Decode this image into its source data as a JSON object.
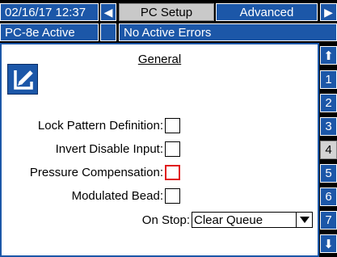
{
  "header": {
    "datetime": "02/16/17 12:37",
    "nav_left": "◀",
    "screen_title": "PC Setup",
    "advanced_tab": "Advanced",
    "nav_right": "▶",
    "status": "PC-8e Active",
    "errors": "No Active Errors"
  },
  "panel": {
    "title": "General",
    "edit_icon": "edit-pencil-icon",
    "settings": [
      {
        "label": "Lock Pattern Definition:",
        "checked": false
      },
      {
        "label": "Invert Disable Input:",
        "checked": false
      },
      {
        "label": "Pressure Compensation:",
        "checked": false,
        "focused": true
      },
      {
        "label": "Modulated Bead:",
        "checked": false
      }
    ],
    "on_stop": {
      "label": "On Stop:",
      "value": "Clear Queue"
    }
  },
  "side_tabs": {
    "up": "⬆",
    "down": "⬇",
    "pages": [
      "1",
      "2",
      "3",
      "4",
      "5",
      "6",
      "7"
    ],
    "active_page": "4"
  },
  "colors": {
    "accent": "#1c57a8",
    "focus": "#e0191a",
    "tab_active": "#d4d4d4"
  }
}
